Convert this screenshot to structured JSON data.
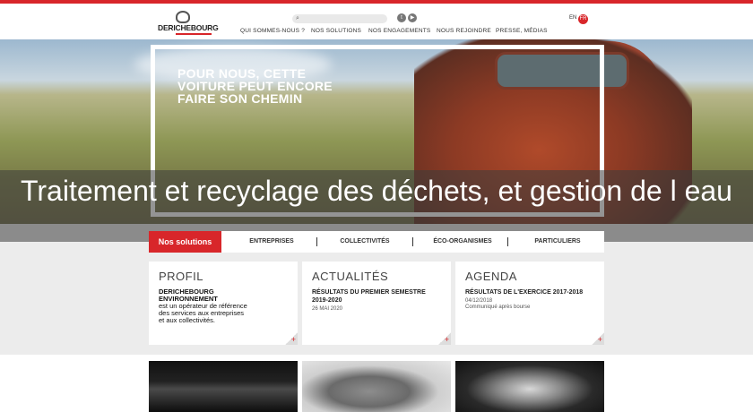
{
  "header": {
    "logo_text": "DERICHEBOURG",
    "social": [
      "twitter-icon",
      "youtube-icon"
    ],
    "nav": [
      "QUI SOMMES-NOUS ?",
      "NOS SOLUTIONS",
      "NOS ENGAGEMENTS",
      "NOUS REJOINDRE",
      "PRESSE, MÉDIAS"
    ],
    "lang_en": "EN",
    "lang_fr": "FR"
  },
  "hero": {
    "tagline": "POUR NOUS, CETTE VOITURE PEUT ENCORE FAIRE SON CHEMIN"
  },
  "overlay": {
    "title": "Traitement et recyclage des déchets, et gestion de l eau"
  },
  "tabs": {
    "active": "Nos solutions",
    "items": [
      "ENTREPRISES",
      "COLLECTIVITÉS",
      "ÉCO-ORGANISMES",
      "PARTICULIERS"
    ]
  },
  "cards": {
    "profil": {
      "heading": "PROFIL",
      "name_line1": "DERICHEBOURG",
      "name_line2": "ENVIRONNEMENT",
      "desc1": "est un opérateur de référence",
      "desc2": "des services aux entreprises",
      "desc3": "et aux collectivités."
    },
    "actualites": {
      "heading": "ACTUALITÉS",
      "title_line1": "RÉSULTATS DU PREMIER SEMESTRE",
      "title_line2": "2019-2020",
      "date": "26 MAI 2020"
    },
    "agenda": {
      "heading": "AGENDA",
      "title": "RÉSULTATS DE L'EXERCICE 2017-2018",
      "date": "04/12/2018",
      "desc": "Communiqué après bourse"
    },
    "plus": "+"
  },
  "colors": {
    "brand_red": "#d8262a"
  }
}
